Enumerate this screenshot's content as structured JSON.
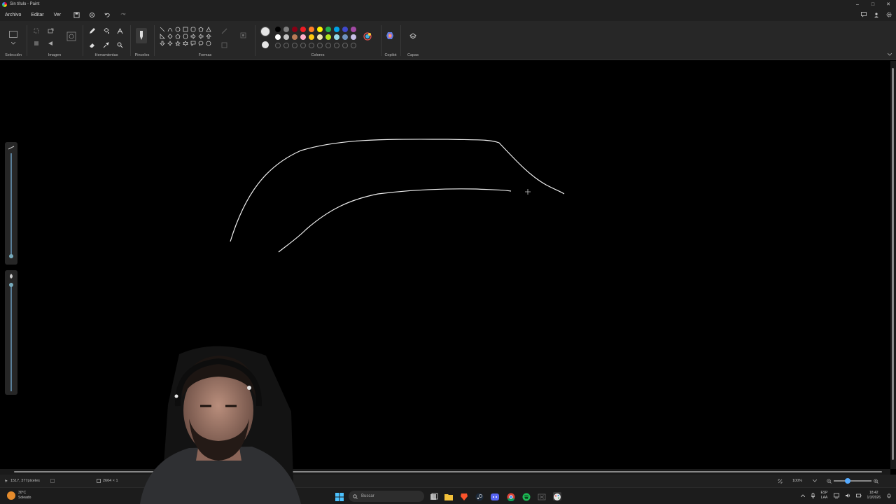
{
  "window": {
    "title": "Sin título - Paint"
  },
  "menu": {
    "items": [
      "Archivo",
      "Editar",
      "Ver"
    ]
  },
  "ribbon": {
    "groups": {
      "selection": "Selección",
      "image": "Imagen",
      "tools": "Herramientas",
      "brushes": "Pinceles",
      "shapes": "Formas",
      "colors": "Colores",
      "copilot": "Copilot",
      "layers": "Capas"
    },
    "palette_row1": [
      "#000000",
      "#7f7f7f",
      "#880015",
      "#ed1c24",
      "#ff7f27",
      "#fff200",
      "#22b14c",
      "#00a2e8",
      "#3f48cc",
      "#a349a4"
    ],
    "palette_row2": [
      "#ffffff",
      "#c3c3c3",
      "#b97a57",
      "#ffaec9",
      "#ffc90e",
      "#efe4b0",
      "#b5e61d",
      "#99d9ea",
      "#7092be",
      "#c8bfe7"
    ],
    "primary_color": "#e6e6e6",
    "secondary_color": "#e6e6e6"
  },
  "status": {
    "cursor_position": "1517, 377píxeles",
    "canvas_size": "2664 × 1",
    "zoom": "100%"
  },
  "taskbar": {
    "search_placeholder": "Buscar",
    "weather_temp": "30°C",
    "weather_desc": "Soleado",
    "lang_top": "ESP",
    "lang_bottom": "LAA",
    "time": "18:42",
    "date": "1/3/2026"
  }
}
